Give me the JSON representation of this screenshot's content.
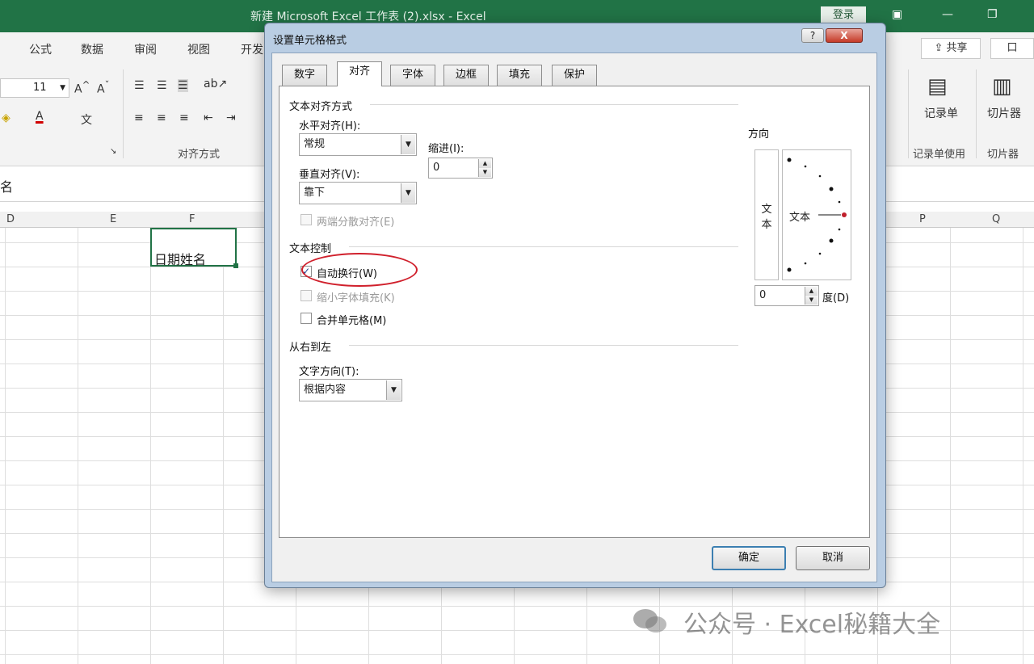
{
  "window": {
    "title": "新建 Microsoft Excel 工作表 (2).xlsx  -  Excel",
    "login_label": "登录"
  },
  "ribbon": {
    "tabs": [
      "公式",
      "数据",
      "审阅",
      "视图",
      "开发"
    ],
    "share_label": "共享",
    "comment_label": "口",
    "font_size": "11",
    "alignment_group_label": "对齐方式",
    "record_form_label": "记录单",
    "record_form_group_label": "记录单使用",
    "slicer_label": "切片器",
    "slicer_group_label": "切片器"
  },
  "formula_bar": {
    "name_text": "名"
  },
  "sheet": {
    "columns": [
      "D",
      "E",
      "F",
      "P",
      "Q"
    ],
    "active_cell_text": "日期姓名"
  },
  "dialog": {
    "title": "设置单元格格式",
    "help_label": "?",
    "close_label": "X",
    "tabs": [
      "数字",
      "对齐",
      "字体",
      "边框",
      "填充",
      "保护"
    ],
    "active_tab": "对齐",
    "text_alignment": {
      "section_title": "文本对齐方式",
      "horizontal_label": "水平对齐(H):",
      "horizontal_value": "常规",
      "vertical_label": "垂直对齐(V):",
      "vertical_value": "靠下",
      "indent_label": "缩进(I):",
      "indent_value": "0",
      "distributed_label": "两端分散对齐(E)"
    },
    "text_control": {
      "section_title": "文本控制",
      "wrap_text_label": "自动换行(W)",
      "wrap_text_checked": true,
      "shrink_label": "缩小字体填充(K)",
      "merge_label": "合并单元格(M)"
    },
    "rtl": {
      "section_title": "从右到左",
      "direction_label": "文字方向(T):",
      "direction_value": "根据内容"
    },
    "orientation": {
      "section_title": "方向",
      "vertical_text_chars": [
        "文",
        "本"
      ],
      "dial_text": "文本",
      "degrees_value": "0",
      "degrees_label": "度(D)"
    },
    "ok_label": "确定",
    "cancel_label": "取消"
  },
  "watermark": {
    "text": "公众号 · Excel秘籍大全"
  },
  "colors": {
    "excel_green": "#217346",
    "oval_red": "#d0202c",
    "dial_red": "#c0202c"
  }
}
